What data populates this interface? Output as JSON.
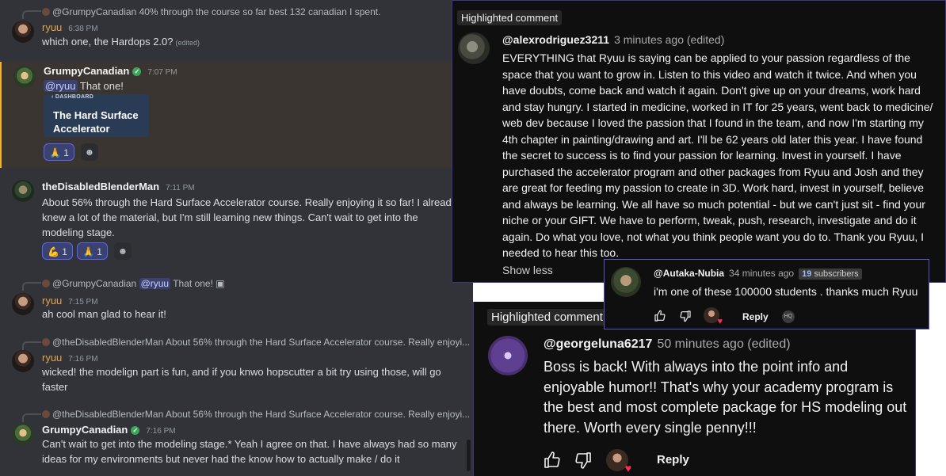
{
  "discord": {
    "messages": [
      {
        "reply": "@GrumpyCanadian 40% through the course so far best 132 canadian I spent.",
        "user": "ryuu",
        "time": "6:38 PM",
        "text": "which one, the Hardops 2.0?",
        "edited": "(edited)"
      },
      {
        "user": "GrumpyCanadian",
        "time": "7:07 PM",
        "mention": "@ryuu",
        "text": " That one!",
        "embed": {
          "label": "DASHBOARD",
          "title": "The Hard Surface Accelerator"
        },
        "reactions": [
          {
            "emoji": "🙏",
            "count": "1"
          }
        ]
      },
      {
        "user": "theDisabledBlenderMan",
        "time": "7:11 PM",
        "text": "About 56% through the Hard Surface Accelerator course. Really enjoying it so far! I already knew a lot of the material, but I'm still learning new things. Can't wait to get into the modeling stage.",
        "reactions": [
          {
            "emoji": "💪",
            "count": "1"
          },
          {
            "emoji": "🙏",
            "count": "1"
          }
        ]
      },
      {
        "reply_user": "@GrumpyCanadian",
        "reply_mention": "@ryuu",
        "reply_text": " That one!",
        "user": "ryuu",
        "time": "7:15 PM",
        "text": "ah cool man glad to hear it!"
      },
      {
        "reply": "@theDisabledBlenderMan About 56% through the Hard Surface Accelerator course. Really enjoyi...",
        "user": "ryuu",
        "time": "7:16 PM",
        "text": "wicked! the modelign part is fun, and if you knwo hopscutter a bit try using those, will go faster"
      },
      {
        "reply": "@theDisabledBlenderMan About 56% through the Hard Surface Accelerator course. Really enjoyi...",
        "user": "GrumpyCanadian",
        "time": "7:16 PM",
        "text": "Can't wait to get into the modeling stage.* Yeah I agree on that. I have always had so many ideas for my environments but never had the know how to actually make / do it"
      }
    ]
  },
  "youtube_top": {
    "label": "Highlighted comment",
    "handle": "@alexrodriguez3211",
    "ago": "3 minutes ago (edited)",
    "text": "EVERYTHING that Ryuu is saying can be applied to your passion regardless of the space that you want to grow in. Listen to this video and watch it twice. And when you have doubts, come back and watch it again. Don't give up on your dreams, work hard and stay hungry. I started in medicine, worked in IT for 25 years, went back to medicine/ web dev because I loved the passion that I found in the team, and now I'm starting my 4th chapter in painting/drawing and art. I'll be 62 years old later this year. I have found the secret to success is to find your passion for learning. Invest in yourself. I have purchased the accelerator program and other packages from Ryuu and Josh and they are great for feeding my passion to create in 3D. Work hard, invest in yourself, believe and always be learning. We all have so much potential - but we can't just sit - find your niche or your GIFT. We have to perform, tweak, push, research, investigate and do it again. Do what you love, not what you think people want you do to. Thank you Ryuu, I needed to hear this too.",
    "show_less": "Show less"
  },
  "youtube_reply": {
    "handle": "@Autaka-Nubia",
    "ago": "34 minutes ago",
    "subs_count": "19",
    "subs_label": "subscribers",
    "text": "i'm one of these 100000 students . thanks much Ryuu",
    "reply_label": "Reply",
    "hq": "HQ"
  },
  "youtube_bottom": {
    "label": "Highlighted comment",
    "handle": "@georgeluna6217",
    "ago": "50 minutes ago (edited)",
    "text": "Boss is back! With always into the point info and enjoyable humor!! That's why your academy program is the best and most complete package for HS modeling out there. Worth every single penny!!!",
    "reply_label": "Reply"
  },
  "colors": {
    "discord_bg": "#313338",
    "ryuu_name": "#e3a44d",
    "mention": "#c9cdfb",
    "yt_bg": "#0f0f0f",
    "panel_border": "#5b55c9"
  },
  "icons": [
    "thumbs-up-icon",
    "thumbs-down-icon",
    "heart-icon",
    "add-reaction-icon",
    "verified-badge-icon",
    "image-attachment-icon"
  ]
}
